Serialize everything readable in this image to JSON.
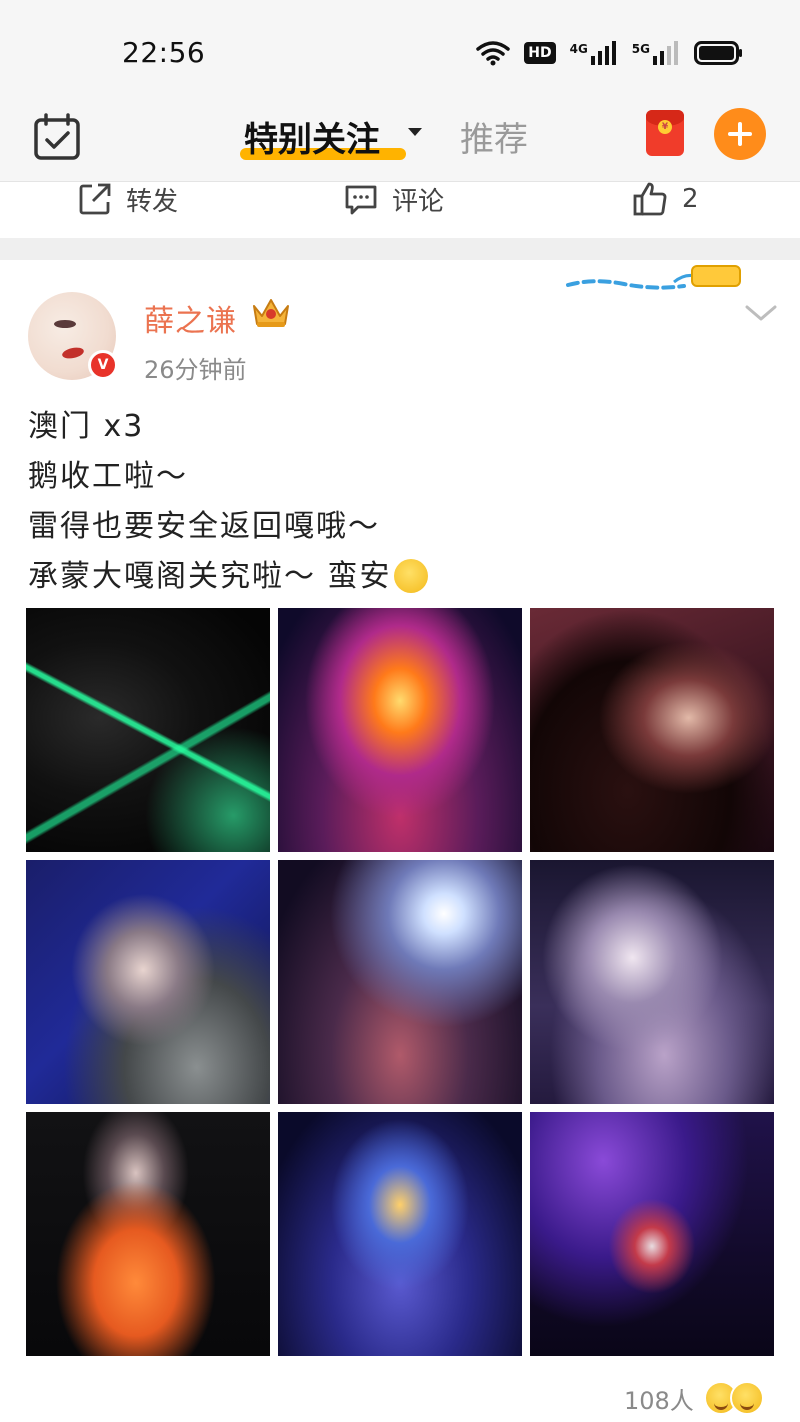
{
  "status_bar": {
    "time": "22:56",
    "hd_label": "HD",
    "net1_label": "4G",
    "net2_label": "5G",
    "icons": [
      "wifi-icon",
      "hd-icon",
      "signal-4g-icon",
      "signal-5g-icon",
      "battery-icon"
    ]
  },
  "nav": {
    "tabs": [
      {
        "label": "特别关注",
        "active": true
      },
      {
        "label": "推荐",
        "active": false
      }
    ],
    "accent_color": "#ffb300",
    "plus_color": "#ff8c1a",
    "icons": [
      "calendar-check-icon",
      "red-packet-icon",
      "plus-icon"
    ]
  },
  "prev_post_actions": {
    "repost_label": "转发",
    "comment_label": "评论",
    "like_count": "2"
  },
  "post": {
    "username": "薛之谦",
    "username_color": "#eb7350",
    "timestamp": "26分钟前",
    "verified_label": "V",
    "lines": [
      "澳门 x3",
      "鹅收工啦～",
      "雷得也要安全返回嘎哦～",
      "承蒙大嘎阁关究啦～ 蛮安"
    ],
    "photos": [
      "concert-photo-green-lasers",
      "concert-photo-stage-crowd",
      "concert-photo-singer-mic",
      "concert-photo-singer-smile",
      "concert-photo-spotlight-crowd",
      "concert-photo-singer-purple",
      "concert-photo-orange-outfit",
      "concert-photo-arena-wide",
      "concert-photo-guitar-stage"
    ],
    "reaction_count": "108人"
  }
}
